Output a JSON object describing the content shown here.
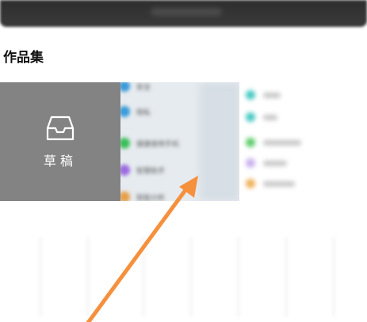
{
  "section": {
    "title": "作品集"
  },
  "draft": {
    "label": "草稿"
  },
  "thumbnail_items": [
    {
      "label": "安全",
      "color": "#3b9ad9"
    },
    {
      "label": "隐私",
      "color": "#3b9ad9"
    },
    {
      "label": "健康使用手机",
      "color": "#3bbf5a"
    },
    {
      "label": "智慧助手",
      "color": "#9a6be0"
    },
    {
      "label": "智能分析",
      "color": "#e6a04a"
    }
  ],
  "colors": {
    "arrow": "#f5903d",
    "draft_bg": "#838383"
  }
}
